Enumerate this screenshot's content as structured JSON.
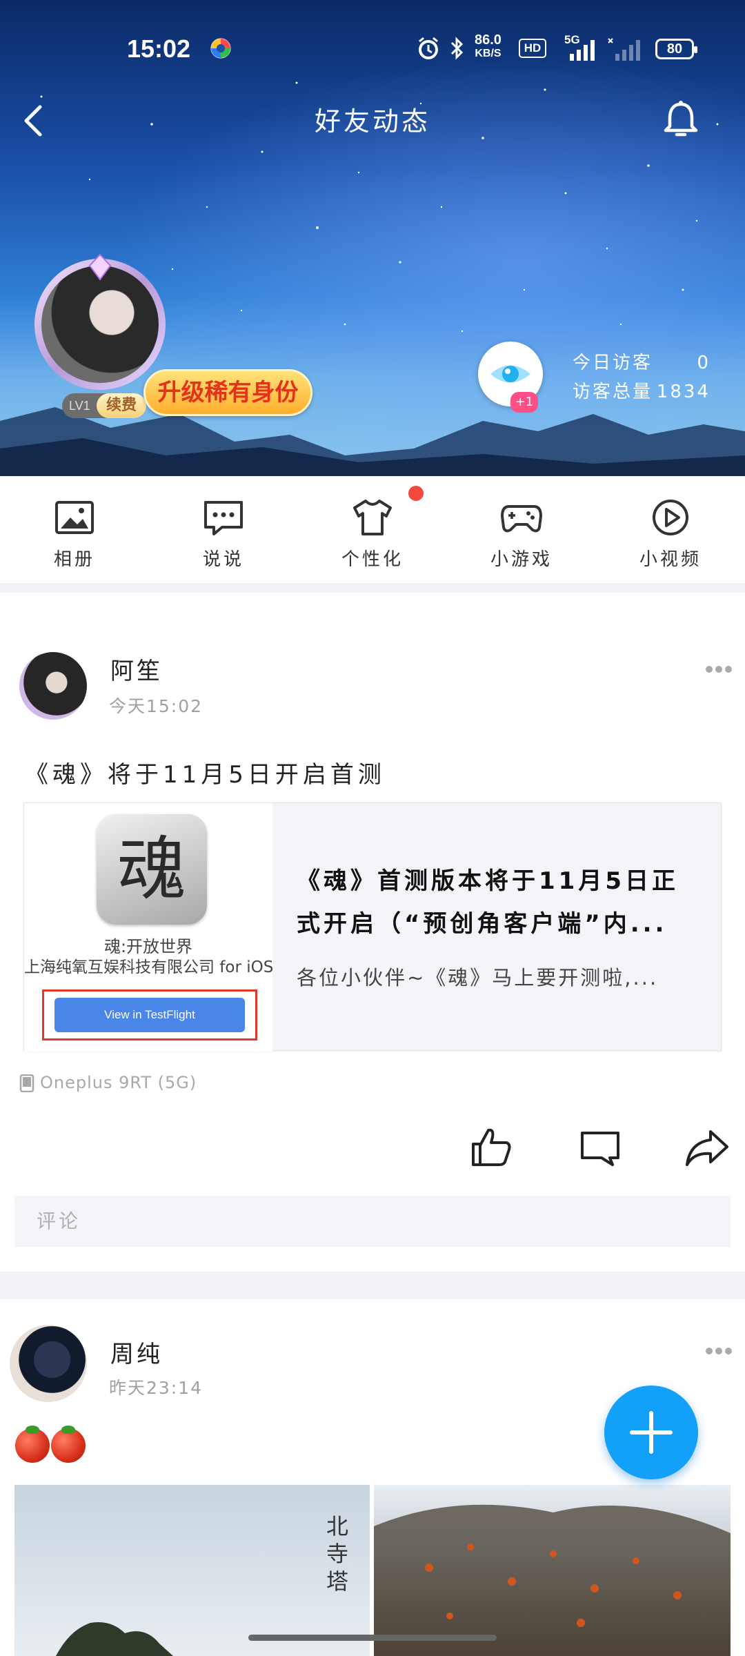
{
  "status_bar": {
    "time": "15:02",
    "net_speed_value": "86.0",
    "net_speed_unit": "KB/S",
    "hd_badge": "HD",
    "network": "5G",
    "battery": "80"
  },
  "nav": {
    "title": "好友动态"
  },
  "profile": {
    "level": "LV1",
    "renew_label": "续费",
    "upgrade_label": "升级稀有身份",
    "visitor_badge": "+1",
    "today_visitors_label": "今日访客",
    "today_visitors_value": "0",
    "total_visitors_label": "访客总量",
    "total_visitors_value": "1834"
  },
  "features": [
    {
      "label": "相册",
      "icon": "photo-album-icon"
    },
    {
      "label": "说说",
      "icon": "chat-bubble-icon"
    },
    {
      "label": "个性化",
      "icon": "tshirt-icon"
    },
    {
      "label": "小游戏",
      "icon": "gamepad-icon"
    },
    {
      "label": "小视频",
      "icon": "play-circle-icon"
    }
  ],
  "posts": [
    {
      "author": "阿笙",
      "time": "今天15:02",
      "text": "《魂》将于11月5日开启首测",
      "card": {
        "app_glyph": "魂",
        "app_name": "魂:开放世界",
        "app_company": "上海纯氧互娱科技有限公司 for iOS",
        "testflight_button": "View in TestFlight",
        "title": "《魂》首测版本将于11月5日正式开启（“预创角客户端”内...",
        "description": "各位小伙伴~《魂》马上要开测啦,..."
      },
      "device": "Oneplus 9RT (5G)",
      "comment_placeholder": "评论"
    },
    {
      "author": "周纯",
      "time": "昨天23:14",
      "photo_caption": "北寺塔"
    }
  ],
  "colors": {
    "accent": "#12a0f8",
    "notification_dot": "#f24a3c",
    "upgrade_text": "#e2321a",
    "visitor_badge": "#ff4f86"
  }
}
